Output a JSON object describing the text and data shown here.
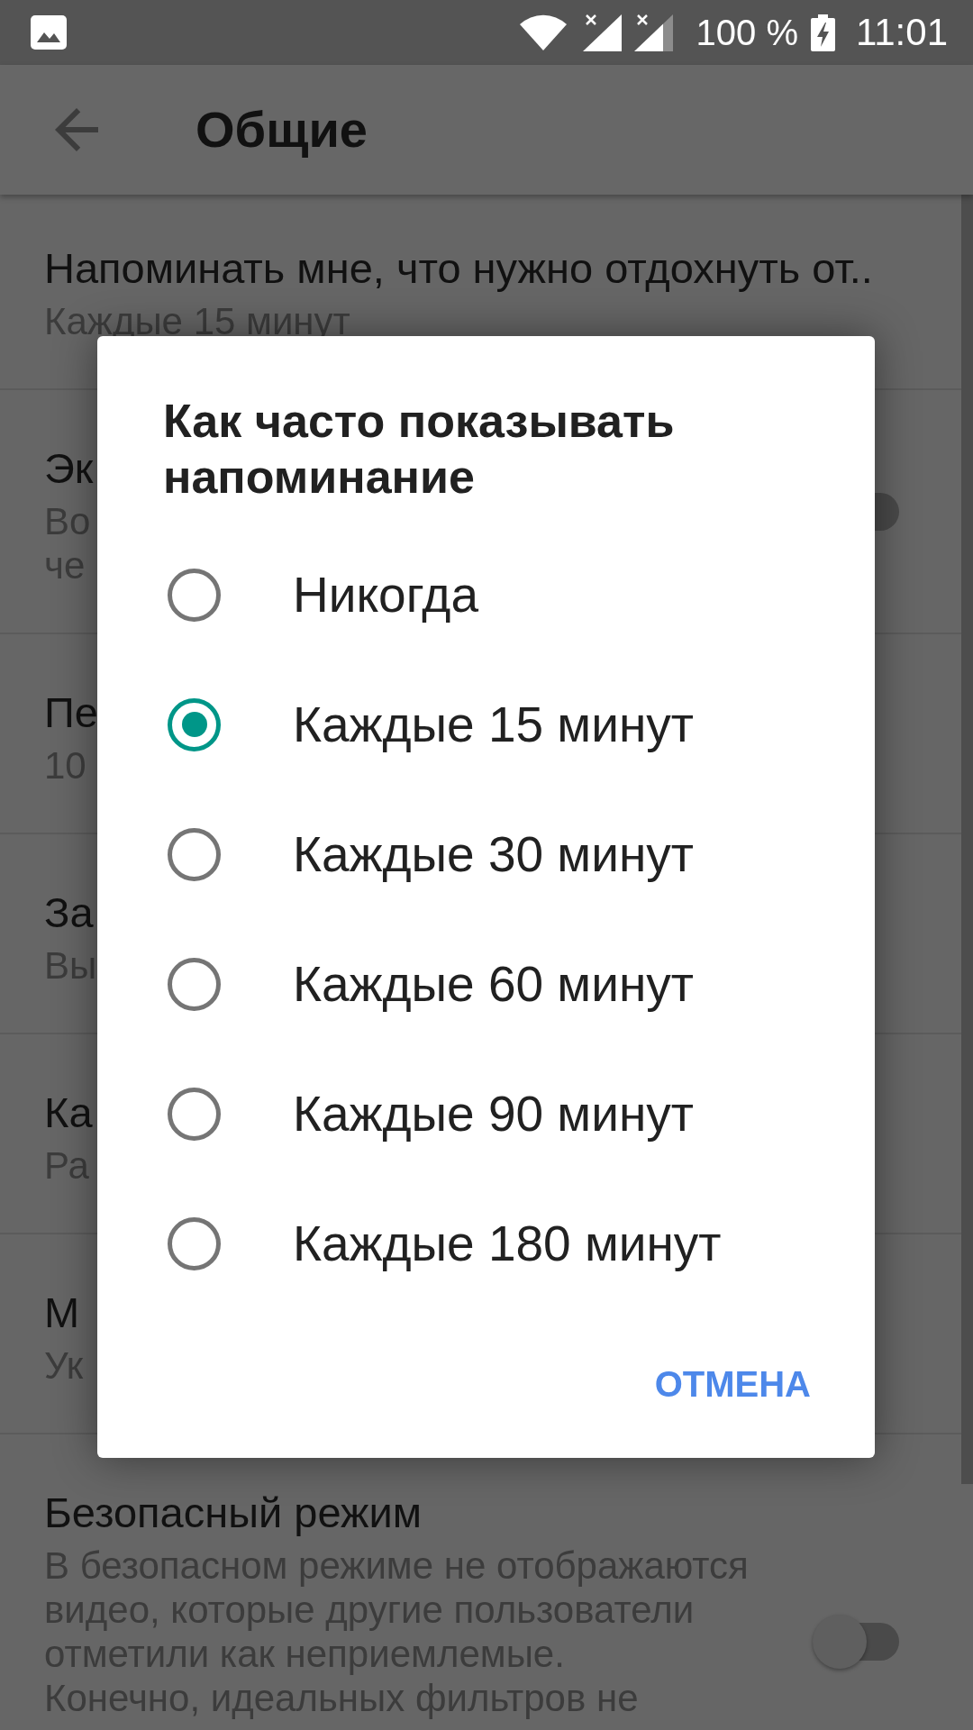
{
  "status_bar": {
    "battery": "100 %",
    "time": "11:01"
  },
  "app_bar": {
    "title": "Общие"
  },
  "settings": [
    {
      "kind": "text",
      "title": "Напоминать мне, что нужно отдохнуть от..",
      "summary": "Каждые 15 минут"
    },
    {
      "kind": "toggle",
      "title": "Эк",
      "summary": "Во\nче",
      "on": false
    },
    {
      "kind": "text",
      "title": "Пе",
      "summary": "10"
    },
    {
      "kind": "text",
      "title": "За",
      "summary": "Вы"
    },
    {
      "kind": "text",
      "title": "Ка",
      "summary": "Ра"
    },
    {
      "kind": "text",
      "title": "М",
      "summary": "Ук"
    },
    {
      "kind": "toggle",
      "title": "Безопасный режим",
      "summary": "В безопасном режиме не отображаются\nвидео, которые другие пользователи\nотметили как неприемлемые.\nКонечно, идеальных фильтров не",
      "on": false
    }
  ],
  "dialog": {
    "title": "Как часто показывать напоминание",
    "options": [
      {
        "label": "Никогда",
        "selected": false
      },
      {
        "label": "Каждые 15 минут",
        "selected": true
      },
      {
        "label": "Каждые 30 минут",
        "selected": false
      },
      {
        "label": "Каждые 60 минут",
        "selected": false
      },
      {
        "label": "Каждые 90 минут",
        "selected": false
      },
      {
        "label": "Каждые 180 минут",
        "selected": false
      }
    ],
    "buttons": [
      "ОТМЕНА"
    ]
  }
}
